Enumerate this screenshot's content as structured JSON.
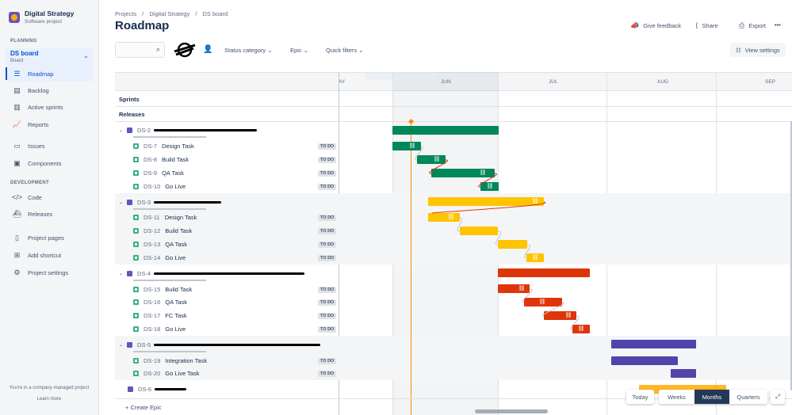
{
  "project": {
    "name": "Digital Strategy",
    "type": "Software project"
  },
  "sidebar": {
    "planning_label": "PLANNING",
    "board": {
      "name": "DS board",
      "sub": "Board"
    },
    "planning_items": [
      {
        "label": "Roadmap",
        "icon": "roadmap-icon"
      },
      {
        "label": "Backlog",
        "icon": "backlog-icon"
      },
      {
        "label": "Active sprints",
        "icon": "sprints-icon"
      },
      {
        "label": "Reports",
        "icon": "reports-icon"
      }
    ],
    "other_items": [
      {
        "label": "Issues",
        "icon": "issues-icon"
      },
      {
        "label": "Components",
        "icon": "components-icon"
      }
    ],
    "development_label": "DEVELOPMENT",
    "dev_items": [
      {
        "label": "Code",
        "icon": "code-icon"
      },
      {
        "label": "Releases",
        "icon": "releases-icon"
      }
    ],
    "bottom_items": [
      {
        "label": "Project pages",
        "icon": "pages-icon"
      },
      {
        "label": "Add shortcut",
        "icon": "shortcut-icon"
      },
      {
        "label": "Project settings",
        "icon": "settings-icon"
      }
    ],
    "footer_text": "You're in a company-managed project",
    "footer_link": "Learn more"
  },
  "breadcrumb": [
    "Projects",
    "/",
    "Digital Strategy",
    "/",
    "DS board"
  ],
  "page_title": "Roadmap",
  "header_actions": {
    "feedback": "Give feedback",
    "share": "Share",
    "export": "Export",
    "more": "•••"
  },
  "toolbar": {
    "status_category": "Status category",
    "epic": "Epic",
    "quick_filters": "Quick filters",
    "view_settings": "View settings"
  },
  "timeline": {
    "months": [
      "AY",
      "JUN",
      "JUL",
      "AUG",
      "SEP"
    ],
    "sprints_label": "Sprints",
    "releases_label": "Releases"
  },
  "epics": [
    {
      "key": "DS-2",
      "color": "#00875a",
      "tasks": [
        {
          "key": "DS-7",
          "name": "Design Task",
          "status": "TO DO"
        },
        {
          "key": "DS-8",
          "name": "Build Task",
          "status": "TO DO"
        },
        {
          "key": "DS-9",
          "name": "QA Task",
          "status": "TO DO"
        },
        {
          "key": "DS-10",
          "name": "Go Live",
          "status": "TO DO"
        }
      ]
    },
    {
      "key": "DS-3",
      "color": "#ffc400",
      "tasks": [
        {
          "key": "DS-11",
          "name": "Design Task",
          "status": "TO DO"
        },
        {
          "key": "DS-12",
          "name": "Build Task",
          "status": "TO DO"
        },
        {
          "key": "DS-13",
          "name": "QA Task",
          "status": "TO DO"
        },
        {
          "key": "DS-14",
          "name": "Go Live",
          "status": "TO DO"
        }
      ]
    },
    {
      "key": "DS-4",
      "color": "#de350b",
      "tasks": [
        {
          "key": "DS-15",
          "name": "Build Task",
          "status": "TO DO"
        },
        {
          "key": "DS-16",
          "name": "QA Task",
          "status": "TO DO"
        },
        {
          "key": "DS-17",
          "name": "FC Task",
          "status": "TO DO"
        },
        {
          "key": "DS-18",
          "name": "Go Live",
          "status": "TO DO"
        }
      ]
    },
    {
      "key": "DS-5",
      "color": "#5243aa",
      "tasks": [
        {
          "key": "DS-19",
          "name": "Integration Task",
          "status": "TO DO"
        },
        {
          "key": "DS-20",
          "name": "Go Live Task",
          "status": "TO DO"
        }
      ]
    },
    {
      "key": "DS-6",
      "color": "#ffab00",
      "tasks": []
    }
  ],
  "create_epic": "+ Create Epic",
  "zoom": {
    "today": "Today",
    "weeks": "Weeks",
    "months": "Months",
    "quarters": "Quarters"
  },
  "link_glyph": "⛓"
}
